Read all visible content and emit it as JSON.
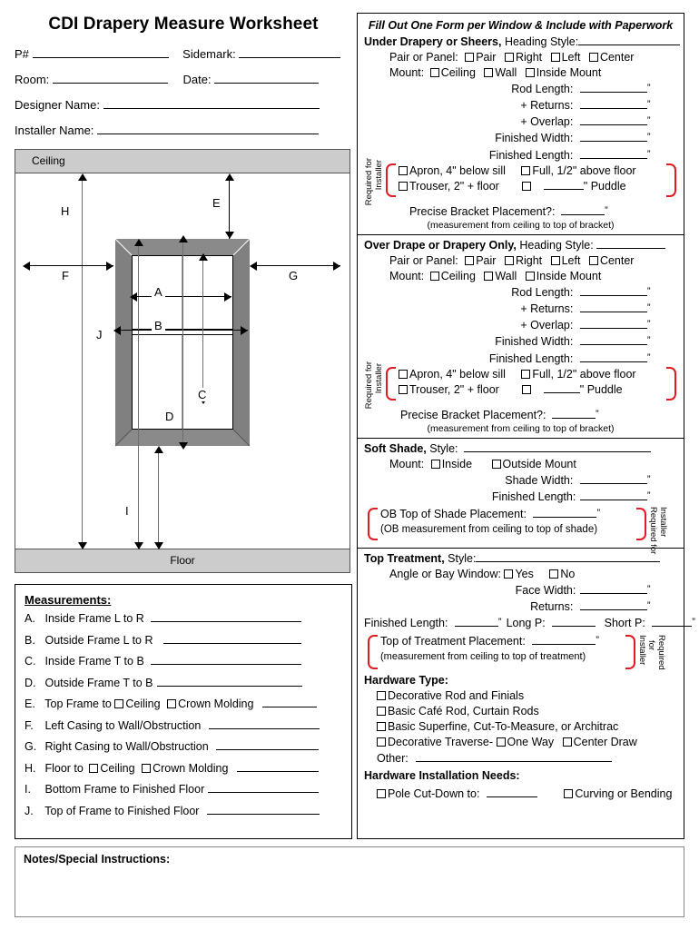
{
  "header": {
    "title": "CDI Drapery Measure Worksheet",
    "fields": [
      {
        "label": "P#",
        "label2": "Sidemark:"
      },
      {
        "label": "Room:",
        "label2": "Date:"
      },
      {
        "label": "Designer Name:"
      },
      {
        "label": "Installer Name:"
      }
    ]
  },
  "diagram": {
    "ceiling_label": "Ceiling",
    "floor_label": "Floor",
    "callouts": [
      "A",
      "B",
      "C",
      "D",
      "E",
      "F",
      "G",
      "H",
      "I",
      "J"
    ]
  },
  "measurements": {
    "heading": "Measurements:",
    "items": [
      {
        "key": "A.",
        "text": "Inside Frame L to R"
      },
      {
        "key": "B.",
        "text": "Outside Frame L to R"
      },
      {
        "key": "C.",
        "text": "Inside Frame T to B"
      },
      {
        "key": "D.",
        "text": "Outside Frame T to B"
      },
      {
        "key": "E.",
        "text": "Top Frame to",
        "check1": "Ceiling",
        "check2": "Crown Molding"
      },
      {
        "key": "F.",
        "text": "Left Casing to Wall/Obstruction"
      },
      {
        "key": "G.",
        "text": "Right Casing to Wall/Obstruction"
      },
      {
        "key": "H.",
        "text": "Floor to",
        "check1": "Ceiling",
        "check2": "Crown Molding"
      },
      {
        "key": "I.",
        "text": "Bottom Frame to Finished Floor"
      },
      {
        "key": "J.",
        "text": "Top of Frame to Finished Floor"
      }
    ]
  },
  "right": {
    "banner": "Fill Out One Form per Window & Include with Paperwork",
    "required_label_line1": "Required for",
    "required_label_line2": "Installer",
    "required_label_a": "Required",
    "required_label_b": "for",
    "required_label_c": "Installer",
    "under": {
      "title": "Under Drapery or Sheers,",
      "heading_style": "Heading Style:",
      "pair_label": "Pair or Panel:",
      "pair_options": [
        "Pair",
        "Right",
        "Left",
        "Center"
      ],
      "mount_label": "Mount:",
      "mount_options": [
        "Ceiling",
        "Wall",
        "Inside Mount"
      ],
      "rod_length": "Rod Length:",
      "returns": "+ Returns:",
      "overlap": "+ Overlap:",
      "finished_width": "Finished Width:",
      "finished_length": "Finished Length:",
      "opt_apron": "Apron, 4\" below sill",
      "opt_full": "Full, 1/2\" above floor",
      "opt_trouser": "Trouser, 2\" + floor",
      "opt_puddle": "\" Puddle",
      "bracket": "Precise Bracket Placement?:",
      "bracket_note": "(measurement from ceiling to top of bracket)"
    },
    "over": {
      "title": "Over Drape or Drapery Only,",
      "heading_style": "Heading Style:",
      "pair_label": "Pair or Panel:",
      "pair_options": [
        "Pair",
        "Right",
        "Left",
        "Center"
      ],
      "mount_label": "Mount:",
      "mount_options": [
        "Ceiling",
        "Wall",
        "Inside Mount"
      ],
      "rod_length": "Rod Length:",
      "returns": "+ Returns:",
      "overlap": "+ Overlap:",
      "finished_width": "Finished Width:",
      "finished_length": "Finished Length:",
      "opt_apron": "Apron, 4\" below sill",
      "opt_full": "Full, 1/2\" above floor",
      "opt_trouser": "Trouser, 2\" + floor",
      "opt_puddle": "\" Puddle",
      "bracket": "Precise Bracket Placement?:",
      "bracket_note": "(measurement from ceiling to top of bracket)"
    },
    "shade": {
      "title": "Soft Shade,",
      "style": "Style:",
      "mount_label": "Mount:",
      "mount_options": [
        "Inside",
        "Outside Mount"
      ],
      "shade_width": "Shade Width:",
      "finished_length": "Finished Length:",
      "ob_placement": "OB Top of Shade Placement:",
      "ob_note": "(OB measurement from ceiling to top of shade)"
    },
    "top_treatment": {
      "title": "Top Treatment,",
      "style": "Style:",
      "angle_label": "Angle or Bay Window:",
      "angle_options": [
        "Yes",
        "No"
      ],
      "face_width": "Face Width:",
      "returns": "Returns:",
      "finished_length": "Finished Length:",
      "long_p": "Long P:",
      "short_p": "Short P:",
      "placement": "Top of Treatment Placement:",
      "placement_note": "(measurement from ceiling to top of treatment)"
    },
    "hardware": {
      "title": "Hardware Type:",
      "options": [
        "Decorative Rod and Finials",
        "Basic Café Rod, Curtain Rods",
        "Basic Superfine, Cut-To-Measure, or Architrac"
      ],
      "traverse": "Decorative Traverse-",
      "traverse_options": [
        "One Way",
        "Center Draw"
      ],
      "other": "Other:",
      "install_title": "Hardware Installation Needs:",
      "pole_cut": "Pole Cut-Down to:",
      "curving": "Curving or Bending"
    }
  },
  "notes": {
    "label": "Notes/Special Instructions:"
  }
}
